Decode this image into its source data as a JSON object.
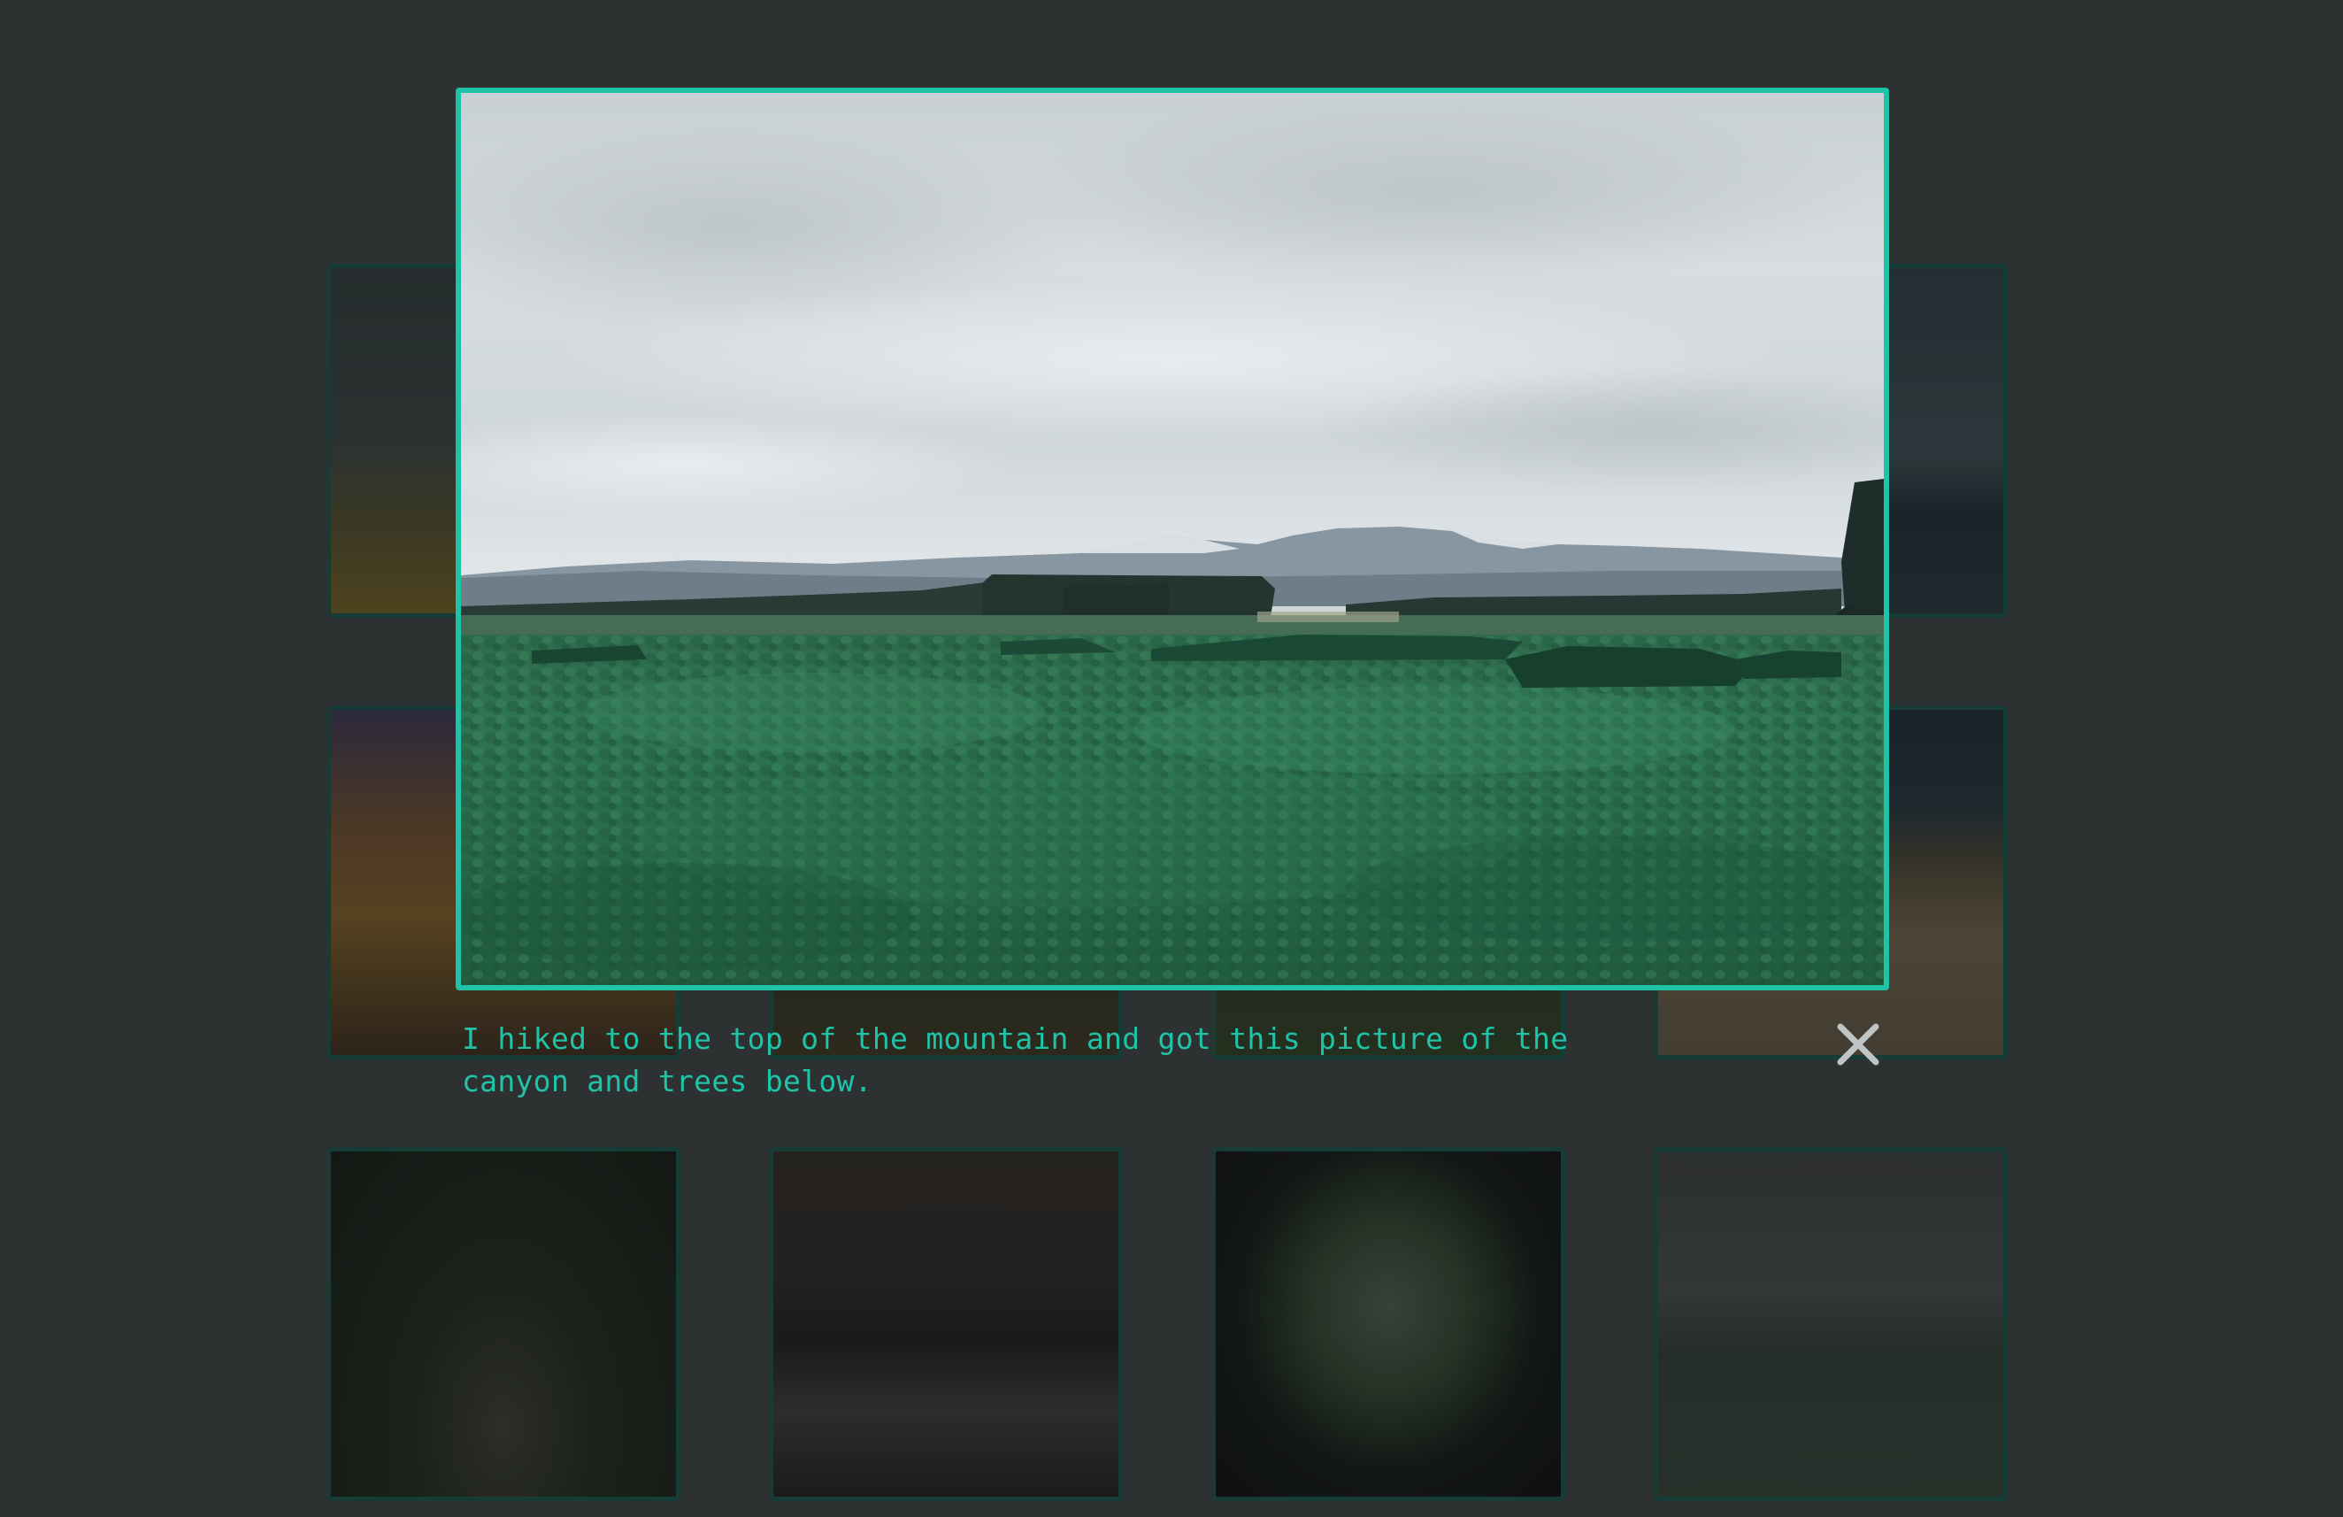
{
  "lightbox": {
    "caption": "I hiked to the top of the mountain and got this picture of the canyon and trees below.",
    "image_subject": "canyon and forest landscape under overcast sky",
    "close_icon": "close-icon",
    "accent_color": "#1fc3a8"
  },
  "gallery": {
    "background_color": "#2e3131",
    "thumbnails": [
      {
        "subject": "golden field landscape"
      },
      {
        "subject": "lake with hills"
      },
      {
        "subject": "red rock cliff"
      },
      {
        "subject": "dark landscape"
      },
      {
        "subject": "dark forest"
      },
      {
        "subject": "beach under dark sky"
      },
      {
        "subject": "forest path between trees"
      },
      {
        "subject": "coastal bay at dusk"
      },
      {
        "subject": "view through cave opening"
      },
      {
        "subject": "snowy mountain over meadow"
      }
    ]
  }
}
